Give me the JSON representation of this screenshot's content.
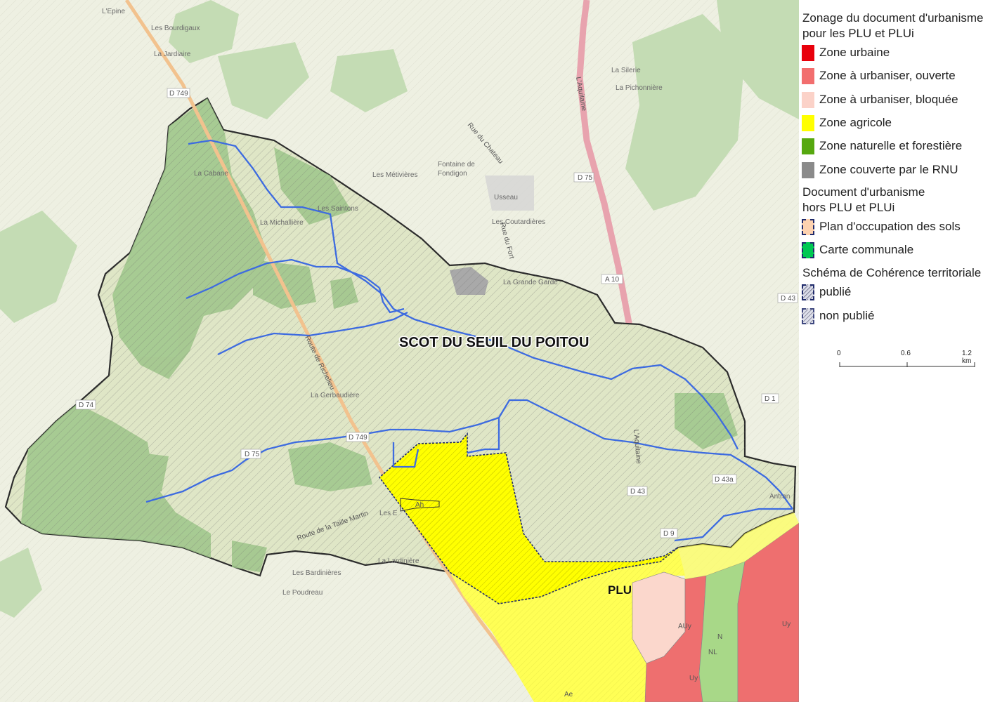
{
  "legend": {
    "title_line1": "Zonage du document d'urbanisme",
    "title_line2": "pour les PLU et PLUi",
    "zones": [
      {
        "label": "Zone urbaine",
        "color": "#e8000b"
      },
      {
        "label": "Zone à urbaniser, ouverte",
        "color": "#f26e6e"
      },
      {
        "label": "Zone à urbaniser, bloquée",
        "color": "#fbd2c8"
      },
      {
        "label": "Zone agricole",
        "color": "#ffff00"
      },
      {
        "label": "Zone naturelle et forestière",
        "color": "#56a80f"
      },
      {
        "label": "Zone couverte par le RNU",
        "color": "#8a8a8a"
      }
    ],
    "hors_title_line1": "Document d'urbanisme",
    "hors_title_line2": "hors PLU et PLUi",
    "hors_items": [
      {
        "label": "Plan d'occupation des sols",
        "color": "#fdd2b0"
      },
      {
        "label": "Carte communale",
        "color": "#00c853"
      }
    ],
    "scot_title": "Schéma de Cohérence territoriale",
    "scot_items": [
      {
        "label": "publié"
      },
      {
        "label": "non publié"
      }
    ],
    "scale": {
      "ticks": [
        "0",
        "0.6",
        "1.2 km"
      ]
    }
  },
  "map": {
    "scot_label": "SCOT DU SEUIL DU POITOU",
    "plu_label": "PLU",
    "place_labels": [
      "L'Epine",
      "Les Bourdigaux",
      "La Jardiaire",
      "La Cabane",
      "La Michallière",
      "Les Saintons",
      "Les Métivières",
      "Fontaine de",
      "Fondigon",
      "Usseau",
      "Les Coutardières",
      "La Grande Garde",
      "La Silerie",
      "La Pichonnière",
      "La Gerbaudière",
      "Les Bardinières",
      "Le Poudreau",
      "La Lardinière",
      "Antran",
      "Les E"
    ],
    "road_labels": [
      "D 749",
      "D 75",
      "D 74",
      "D 43",
      "D 43a",
      "D 9",
      "D 1",
      "A 10",
      "Route de Richelieu",
      "Route de la Taille Martin",
      "L'Aquitaine",
      "Rue du Chateau",
      "Rue du Fort"
    ],
    "zone_codes": [
      "AUy",
      "Uy",
      "N",
      "NL",
      "Ae",
      "Ah"
    ]
  }
}
